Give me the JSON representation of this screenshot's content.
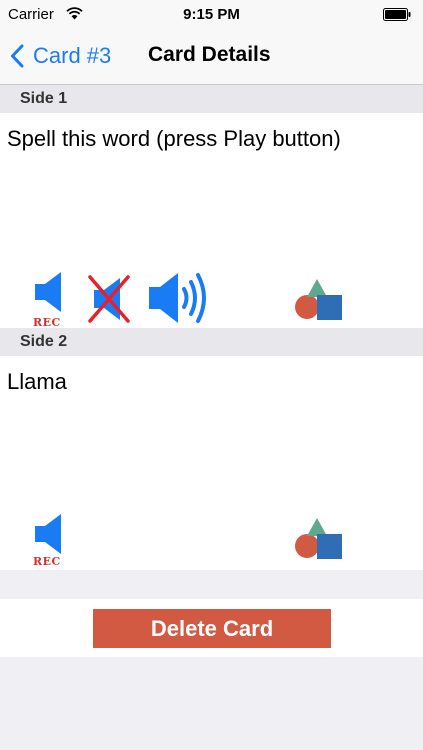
{
  "status_bar": {
    "carrier": "Carrier",
    "time": "9:15 PM"
  },
  "nav": {
    "back_label": "Card #3",
    "title": "Card Details"
  },
  "side1": {
    "header": "Side 1",
    "text": "Spell this word (press Play button)",
    "rec_label": "REC",
    "icons": [
      "speaker-rec-icon",
      "speaker-muted-icon",
      "speaker-play-icon",
      "shapes-icon"
    ]
  },
  "side2": {
    "header": "Side 2",
    "text": "Llama",
    "rec_label": "REC",
    "icons": [
      "speaker-rec-icon",
      "shapes-icon"
    ]
  },
  "actions": {
    "delete_label": "Delete Card"
  },
  "colors": {
    "accent": "#1a7cf5",
    "delete": "#d25a43",
    "rec": "#d0312d",
    "speaker": "#1a7cf5"
  }
}
